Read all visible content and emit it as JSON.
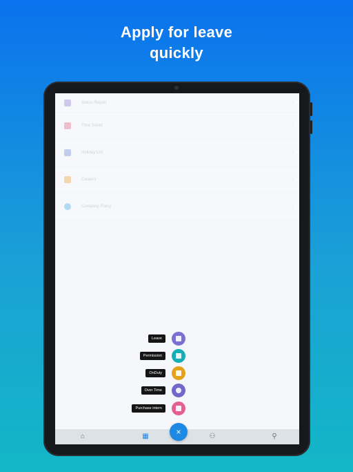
{
  "headline": {
    "line1": "Apply for leave",
    "line2": "quickly"
  },
  "menu": {
    "items": [
      {
        "label": "Status Report",
        "icon": "report-icon",
        "color": "#8c7bd6"
      },
      {
        "label": "Time Sheet",
        "icon": "timesheet-icon",
        "color": "#e55b7b"
      },
      {
        "label": "Holiday List",
        "icon": "holiday-icon",
        "color": "#6c85d8"
      },
      {
        "label": "Careers",
        "icon": "careers-icon",
        "color": "#f0a32b"
      },
      {
        "label": "Company Policy",
        "icon": "policy-icon",
        "color": "#3fa9e6"
      }
    ]
  },
  "fab_menu": {
    "items": [
      {
        "label": "Leave",
        "icon": "calendar-icon",
        "color": "#7b6fd1"
      },
      {
        "label": "Permission",
        "icon": "document-icon",
        "color": "#13aeb6"
      },
      {
        "label": "OnDuty",
        "icon": "briefcase-icon",
        "color": "#e3a21c"
      },
      {
        "label": "Over Time",
        "icon": "clock-icon",
        "color": "#7168c9"
      },
      {
        "label": "Purchase intern",
        "icon": "send-icon",
        "color": "#e35f8f"
      }
    ],
    "close_glyph": "×"
  },
  "bottom_nav": {
    "items": [
      {
        "icon": "home-icon",
        "glyph": "⌂"
      },
      {
        "icon": "grid-icon",
        "glyph": "▦"
      },
      {
        "icon": "people-icon",
        "glyph": "⚇"
      },
      {
        "icon": "profile-icon",
        "glyph": "⚲"
      }
    ]
  }
}
